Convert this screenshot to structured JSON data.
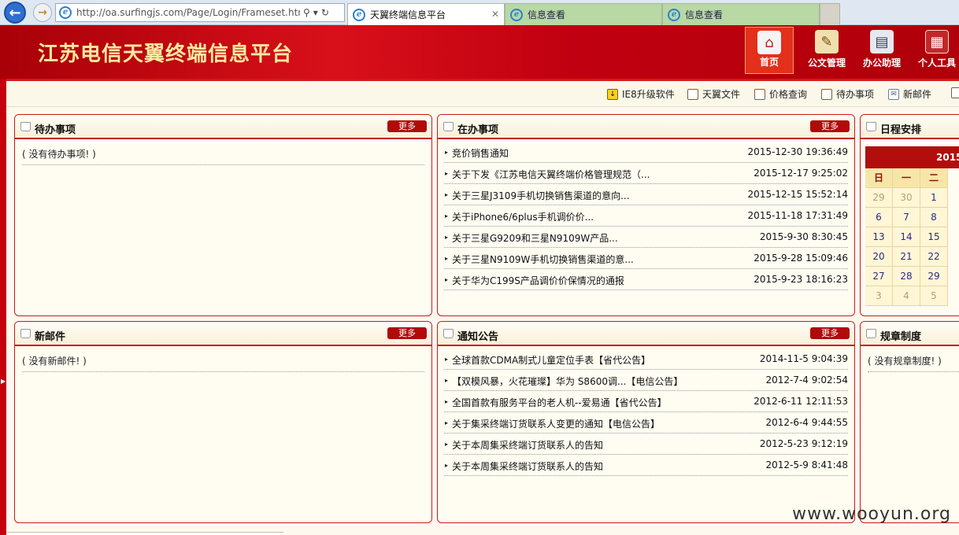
{
  "browser": {
    "url": "http://oa.surfingjs.com/Page/Login/Frameset.htm",
    "tabs": [
      {
        "label": "天翼终端信息平台",
        "active": true
      },
      {
        "label": "信息查看",
        "active": false
      },
      {
        "label": "信息查看",
        "active": false
      }
    ]
  },
  "header": {
    "title": "江苏电信天翼终端信息平台",
    "nav": [
      {
        "label": "首页",
        "icon": "home-icon",
        "active": true
      },
      {
        "label": "公文管理",
        "icon": "document-icon"
      },
      {
        "label": "办公助理",
        "icon": "assistant-icon"
      },
      {
        "label": "个人工具",
        "icon": "toolbox-icon"
      }
    ]
  },
  "toolbar": {
    "links": [
      "IE8升级软件",
      "天翼文件",
      "价格查询",
      "待办事项",
      "新邮件"
    ]
  },
  "more_label": "更多",
  "panels": {
    "todo": {
      "title": "待办事项",
      "empty": "( 没有待办事项! )"
    },
    "doing": {
      "title": "在办事项",
      "items": [
        {
          "text": "竞价销售通知",
          "date": "2015-12-30 19:36:49"
        },
        {
          "text": "关于下发《江苏电信天翼终端价格管理规范（...",
          "date": "2015-12-17 9:25:02"
        },
        {
          "text": "关于三星J3109手机切换销售渠道的意向...",
          "date": "2015-12-15 15:52:14"
        },
        {
          "text": "关于iPhone6/6plus手机调价价...",
          "date": "2015-11-18 17:31:49"
        },
        {
          "text": "关于三星G9209和三星N9109W产品...",
          "date": "2015-9-30 8:30:45"
        },
        {
          "text": "关于三星N9109W手机切换销售渠道的意...",
          "date": "2015-9-28 15:09:46"
        },
        {
          "text": "关于华为C199S产品调价价保情况的通报",
          "date": "2015-9-23 18:16:23"
        }
      ]
    },
    "schedule": {
      "title": "日程安排",
      "calendar_header": "2015",
      "weekdays": [
        "日",
        "一",
        "二"
      ],
      "weeks": [
        [
          {
            "d": "29",
            "dim": true
          },
          {
            "d": "30",
            "dim": true
          },
          {
            "d": "1"
          }
        ],
        [
          {
            "d": "6"
          },
          {
            "d": "7"
          },
          {
            "d": "8"
          }
        ],
        [
          {
            "d": "13"
          },
          {
            "d": "14"
          },
          {
            "d": "15"
          }
        ],
        [
          {
            "d": "20"
          },
          {
            "d": "21"
          },
          {
            "d": "22"
          }
        ],
        [
          {
            "d": "27"
          },
          {
            "d": "28"
          },
          {
            "d": "29"
          }
        ],
        [
          {
            "d": "3",
            "dim": true
          },
          {
            "d": "4",
            "dim": true
          },
          {
            "d": "5",
            "dim": true
          }
        ]
      ]
    },
    "mail": {
      "title": "新邮件",
      "empty": "( 没有新邮件! )"
    },
    "notice": {
      "title": "通知公告",
      "items": [
        {
          "text": "全球首款CDMA制式儿童定位手表【省代公告】",
          "date": "2014-11-5 9:04:39"
        },
        {
          "text": "【双模风暴，火花璀璨】华为 S8600调...【电信公告】",
          "date": "2012-7-4 9:02:54"
        },
        {
          "text": "全国首款有服务平台的老人机--爱易通【省代公告】",
          "date": "2012-6-11 12:11:53"
        },
        {
          "text": "关于集采终端订货联系人变更的通知【电信公告】",
          "date": "2012-6-4 9:44:55"
        },
        {
          "text": "关于本周集采终端订货联系人的告知",
          "date": "2012-5-23 9:12:19"
        },
        {
          "text": "关于本周集采终端订货联系人的告知",
          "date": "2012-5-9 8:41:48"
        }
      ]
    },
    "rules": {
      "title": "规章制度",
      "empty": "( 没有规章制度! )"
    }
  },
  "watermark": "www.wooyun.org",
  "colors": {
    "header_red": "#c8101a",
    "title_gold": "#ffe9a0",
    "more_button": "#b00a0a"
  }
}
